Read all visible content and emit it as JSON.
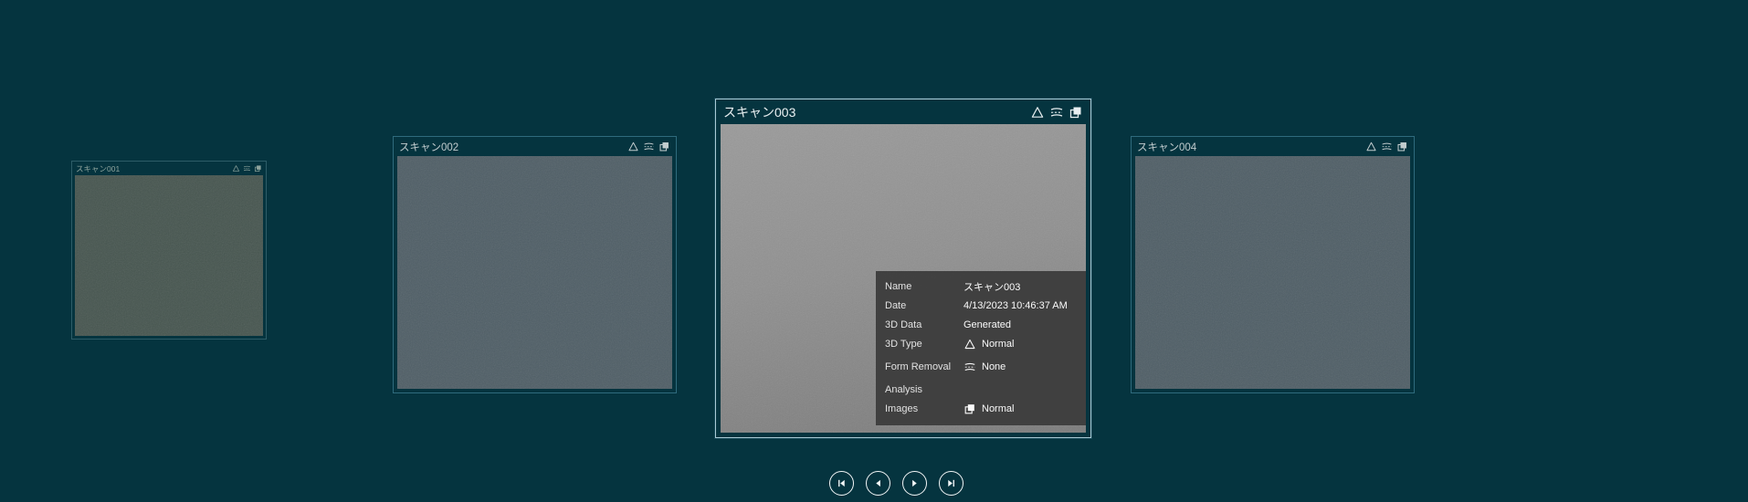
{
  "colors": {
    "background": "#05343f",
    "selected_card_border": "#a9c9d4",
    "unselected_card_border": "#2f6b7d",
    "info_panel_background": "#3c3c3c",
    "nav_button_color": "#f2f6f7"
  },
  "cards": [
    {
      "title": "スキャン001",
      "selected": false,
      "icons": [
        "3d-type-triangle-icon",
        "form-removal-icon",
        "images-icon"
      ]
    },
    {
      "title": "スキャン002",
      "selected": false,
      "icons": [
        "3d-type-triangle-icon",
        "form-removal-icon",
        "images-icon"
      ]
    },
    {
      "title": "スキャン003",
      "selected": true,
      "icons": [
        "3d-type-triangle-icon",
        "form-removal-icon",
        "images-icon"
      ]
    },
    {
      "title": "スキャン004",
      "selected": false,
      "icons": [
        "3d-type-triangle-icon",
        "form-removal-icon",
        "images-icon"
      ]
    }
  ],
  "info_panel": {
    "rows": [
      {
        "label": "Name",
        "value": "スキャン003"
      },
      {
        "label": "Date",
        "value": "4/13/2023 10:46:37 AM"
      },
      {
        "label": "3D Data",
        "value": "Generated"
      },
      {
        "label": "3D Type",
        "value": "Normal",
        "icon": "triangle-icon"
      },
      {
        "label": "Form Removal",
        "value": "None",
        "icon": "form-removal-icon"
      },
      {
        "label": "Analysis",
        "value": ""
      },
      {
        "label": "Images",
        "value": "Normal",
        "icon": "images-icon"
      }
    ]
  },
  "navigation": {
    "buttons": [
      {
        "name": "first"
      },
      {
        "name": "previous"
      },
      {
        "name": "next"
      },
      {
        "name": "last"
      }
    ]
  }
}
